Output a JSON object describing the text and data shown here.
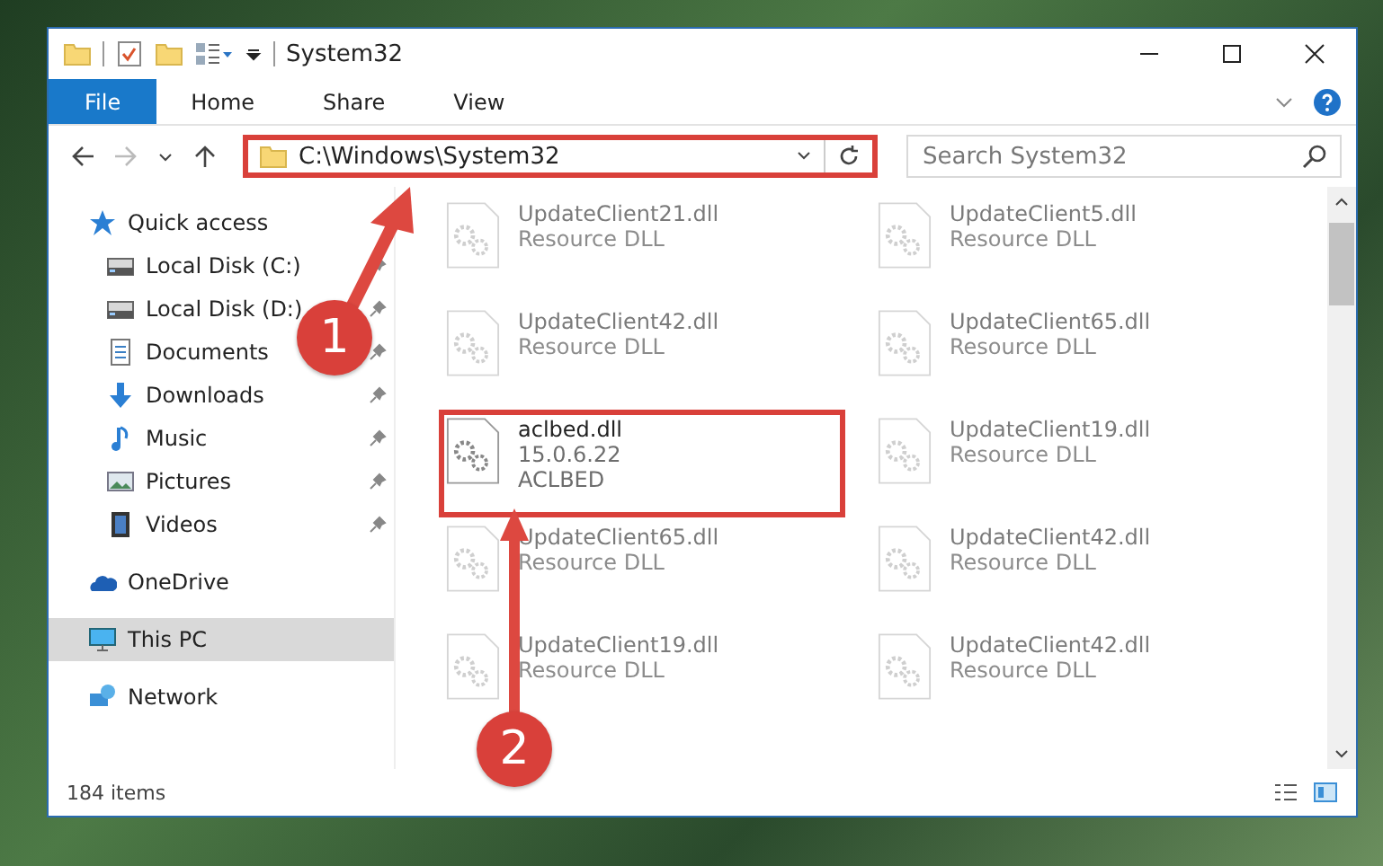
{
  "window": {
    "title": "System32"
  },
  "ribbon": {
    "tabs": [
      {
        "label": "File",
        "selected": true
      },
      {
        "label": "Home",
        "selected": false
      },
      {
        "label": "Share",
        "selected": false
      },
      {
        "label": "View",
        "selected": false
      }
    ]
  },
  "address_bar": {
    "path": "C:\\Windows\\System32",
    "highlighted": true
  },
  "search": {
    "placeholder": "Search System32"
  },
  "sidebar": {
    "items": [
      {
        "label": "Quick access",
        "kind": "star",
        "selected": false,
        "children": [
          {
            "label": "Local Disk (C:)",
            "kind": "drive",
            "pinned": true
          },
          {
            "label": "Local Disk (D:)",
            "kind": "drive",
            "pinned": true
          },
          {
            "label": "Documents",
            "kind": "document",
            "pinned": true
          },
          {
            "label": "Downloads",
            "kind": "download",
            "pinned": true
          },
          {
            "label": "Music",
            "kind": "music",
            "pinned": true
          },
          {
            "label": "Pictures",
            "kind": "picture",
            "pinned": true
          },
          {
            "label": "Videos",
            "kind": "video",
            "pinned": true
          }
        ]
      },
      {
        "label": "OneDrive",
        "kind": "cloud",
        "selected": false
      },
      {
        "label": "This PC",
        "kind": "pc",
        "selected": true
      },
      {
        "label": "Network",
        "kind": "network",
        "selected": false
      }
    ]
  },
  "files": [
    {
      "name": "UpdateClient21.dll",
      "description": "Resource DLL",
      "faded": true,
      "highlighted": false
    },
    {
      "name": "UpdateClient5.dll",
      "description": "Resource DLL",
      "faded": true,
      "highlighted": false
    },
    {
      "name": "UpdateClient42.dll",
      "description": "Resource DLL",
      "faded": true,
      "highlighted": false
    },
    {
      "name": "UpdateClient65.dll",
      "description": "Resource DLL",
      "faded": true,
      "highlighted": false
    },
    {
      "name": "aclbed.dll",
      "version": "15.0.6.22",
      "description": "ACLBED",
      "faded": false,
      "highlighted": true
    },
    {
      "name": "UpdateClient19.dll",
      "description": "Resource DLL",
      "faded": true,
      "highlighted": false
    },
    {
      "name": "UpdateClient65.dll",
      "description": "Resource DLL",
      "faded": true,
      "highlighted": false
    },
    {
      "name": "UpdateClient42.dll",
      "description": "Resource DLL",
      "faded": true,
      "highlighted": false
    },
    {
      "name": "UpdateClient19.dll",
      "description": "Resource DLL",
      "faded": true,
      "highlighted": false
    },
    {
      "name": "UpdateClient42.dll",
      "description": "Resource DLL",
      "faded": true,
      "highlighted": false
    }
  ],
  "status_bar": {
    "item_count": "184 items"
  },
  "annotations": [
    {
      "number": "1"
    },
    {
      "number": "2"
    }
  ]
}
